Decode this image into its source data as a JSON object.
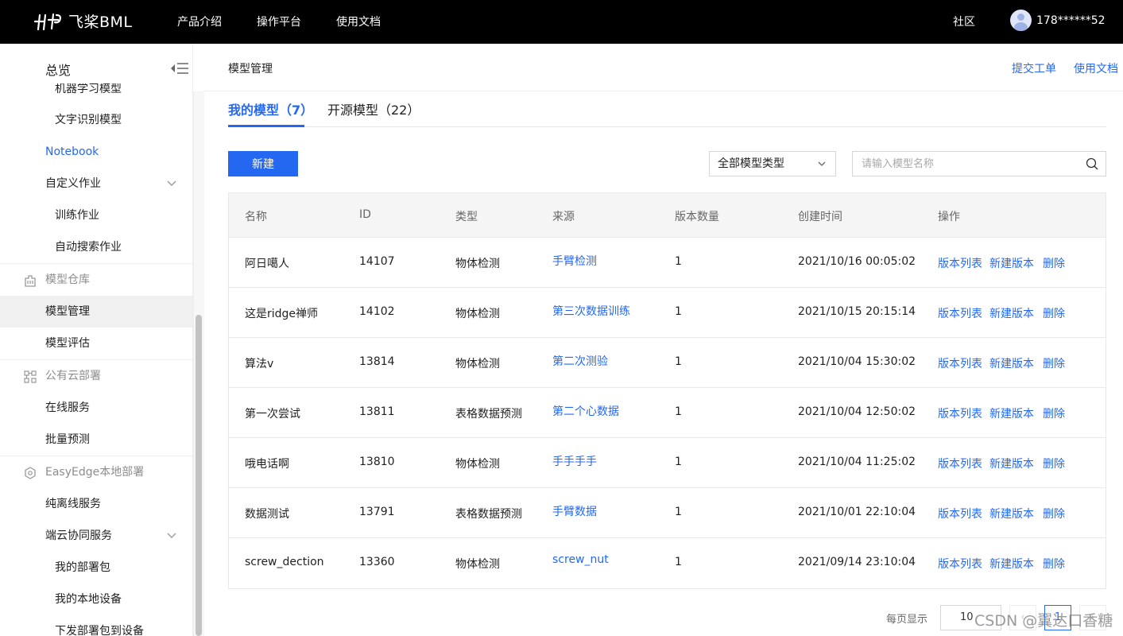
{
  "topbar": {
    "logo_text": "飞桨BML",
    "nav": [
      "产品介绍",
      "操作平台",
      "使用文档"
    ],
    "community": "社区",
    "user_name": "178******52"
  },
  "sidebar": {
    "title": "总览",
    "cut_item": "机器学习模型",
    "items": [
      {
        "label": "文字识别模型"
      },
      {
        "label": "Notebook"
      },
      {
        "label": "自定义作业"
      },
      {
        "label": "训练作业"
      },
      {
        "label": "自动搜索作业"
      },
      {
        "label": "模型仓库"
      },
      {
        "label": "模型管理"
      },
      {
        "label": "模型评估"
      },
      {
        "label": "公有云部署"
      },
      {
        "label": "在线服务"
      },
      {
        "label": "批量预测"
      },
      {
        "label": "EasyEdge本地部署"
      },
      {
        "label": "纯离线服务"
      },
      {
        "label": "端云协同服务"
      },
      {
        "label": "我的部署包"
      },
      {
        "label": "我的本地设备"
      },
      {
        "label": "下发部署包到设备"
      }
    ]
  },
  "header": {
    "title": "模型管理",
    "links": [
      "提交工单",
      "使用文档"
    ]
  },
  "tabs": [
    {
      "label": "我的模型（7）"
    },
    {
      "label": "开源模型（22）"
    }
  ],
  "toolbar": {
    "new_label": "新建",
    "type_select": "全部模型类型",
    "search_placeholder": "请输入模型名称"
  },
  "table": {
    "columns": [
      "名称",
      "ID",
      "类型",
      "来源",
      "版本数量",
      "创建时间",
      "操作"
    ],
    "ops": [
      "版本列表",
      "新建版本",
      "删除"
    ],
    "rows": [
      {
        "name": "阿日噶人",
        "id": "14107",
        "type": "物体检测",
        "source": "手臂检测",
        "versions": "1",
        "created": "2021/10/16  00:05:02"
      },
      {
        "name": "这是ridge禅师",
        "id": "14102",
        "type": "物体检测",
        "source": "第三次数据训练",
        "versions": "1",
        "created": "2021/10/15  20:15:14"
      },
      {
        "name": "算法v",
        "id": "13814",
        "type": "物体检测",
        "source": "第二次测验",
        "versions": "1",
        "created": "2021/10/04  15:30:02"
      },
      {
        "name": "第一次尝试",
        "id": "13811",
        "type": "表格数据预测",
        "source": "第二个心数据",
        "versions": "1",
        "created": "2021/10/04  12:50:02"
      },
      {
        "name": "哦电话啊",
        "id": "13810",
        "type": "物体检测",
        "source": "手手手手",
        "versions": "1",
        "created": "2021/10/04  11:25:02"
      },
      {
        "name": "数据测试",
        "id": "13791",
        "type": "表格数据预测",
        "source": "手臂数据",
        "versions": "1",
        "created": "2021/10/01  22:10:04"
      },
      {
        "name": "screw_dection",
        "id": "13360",
        "type": "物体检测",
        "source": "screw_nut",
        "versions": "1",
        "created": "2021/09/14  23:10:04"
      }
    ]
  },
  "pager": {
    "label": "每页显示",
    "size": "10",
    "prev": "‹",
    "page": "1",
    "next": "›"
  },
  "watermark": "CSDN @翼达口香糖",
  "colors": {
    "accent": "#2468f2",
    "topbar": "#000000"
  }
}
